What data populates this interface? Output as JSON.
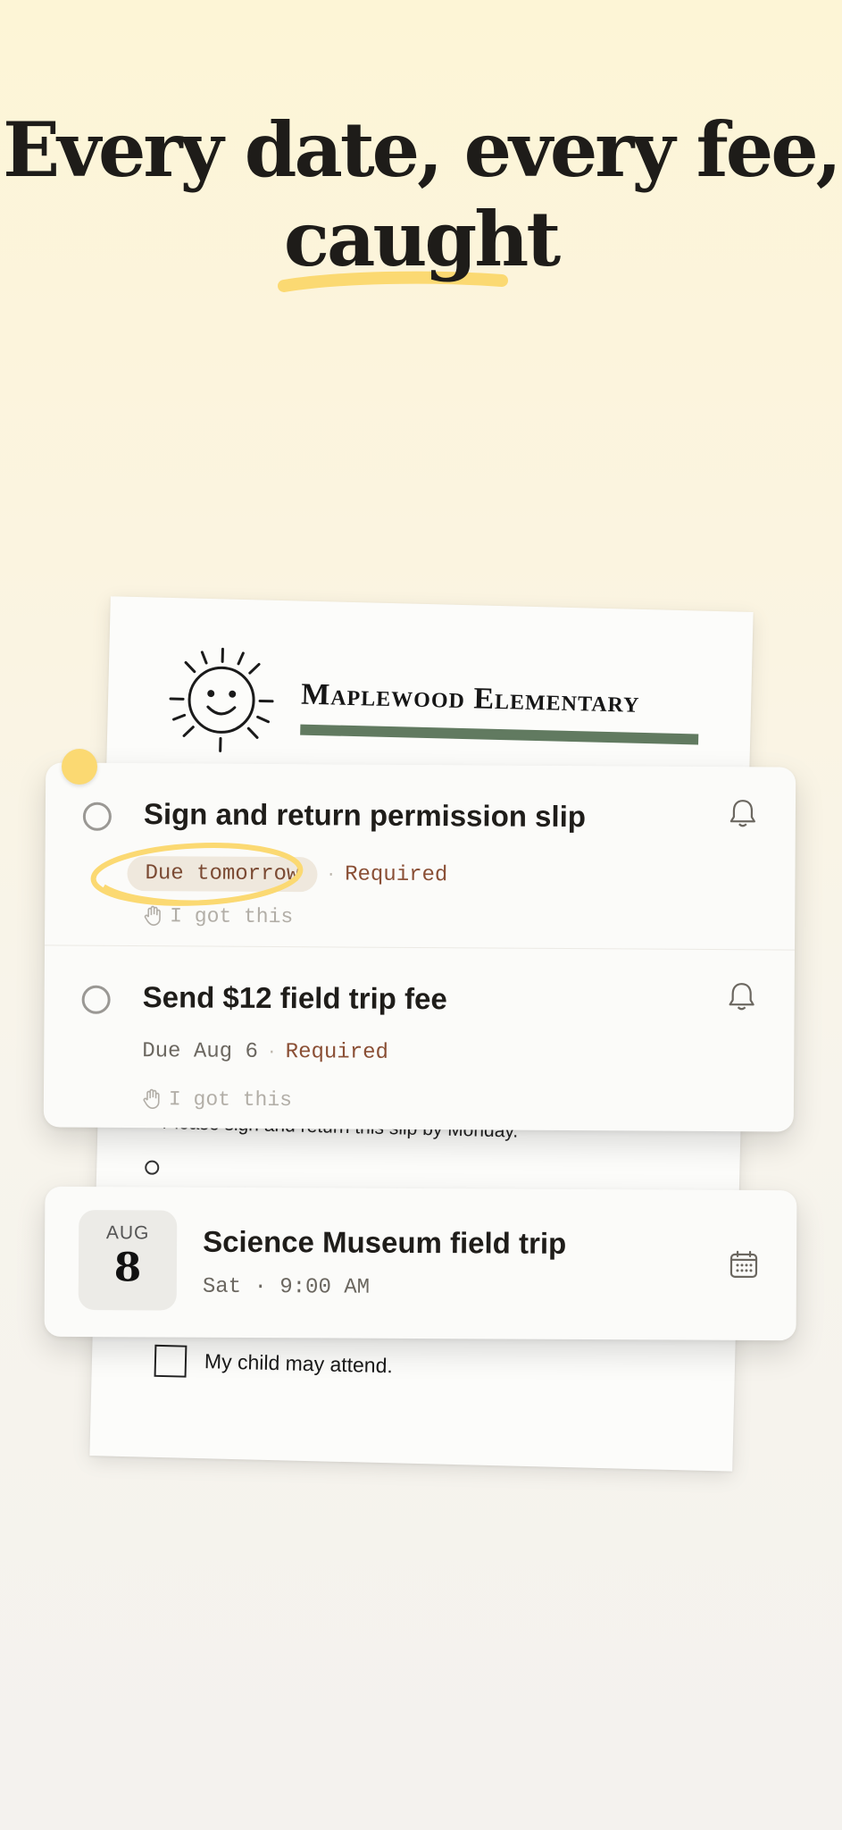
{
  "headline": {
    "line1": "Every date, every fee,",
    "line2": "caught"
  },
  "flyer": {
    "school": "Maplewood Elementary",
    "note": "Please sign and return this slip by Monday.",
    "checkbox_label": "My child may attend."
  },
  "tasks": [
    {
      "title": "Sign and return permission slip",
      "due": "Due tomorrow",
      "tag": "Required",
      "claim": "I got this"
    },
    {
      "title": "Send $12 field trip fee",
      "due": "Due Aug 6",
      "tag": "Required",
      "claim": "I got this"
    }
  ],
  "event": {
    "month": "AUG",
    "day": "8",
    "title": "Science Museum field trip",
    "time": "Sat · 9:00 AM"
  },
  "colors": {
    "accent_yellow": "#fbd972",
    "required_brown": "#8a4f35",
    "flyer_bar": "#617a60"
  }
}
